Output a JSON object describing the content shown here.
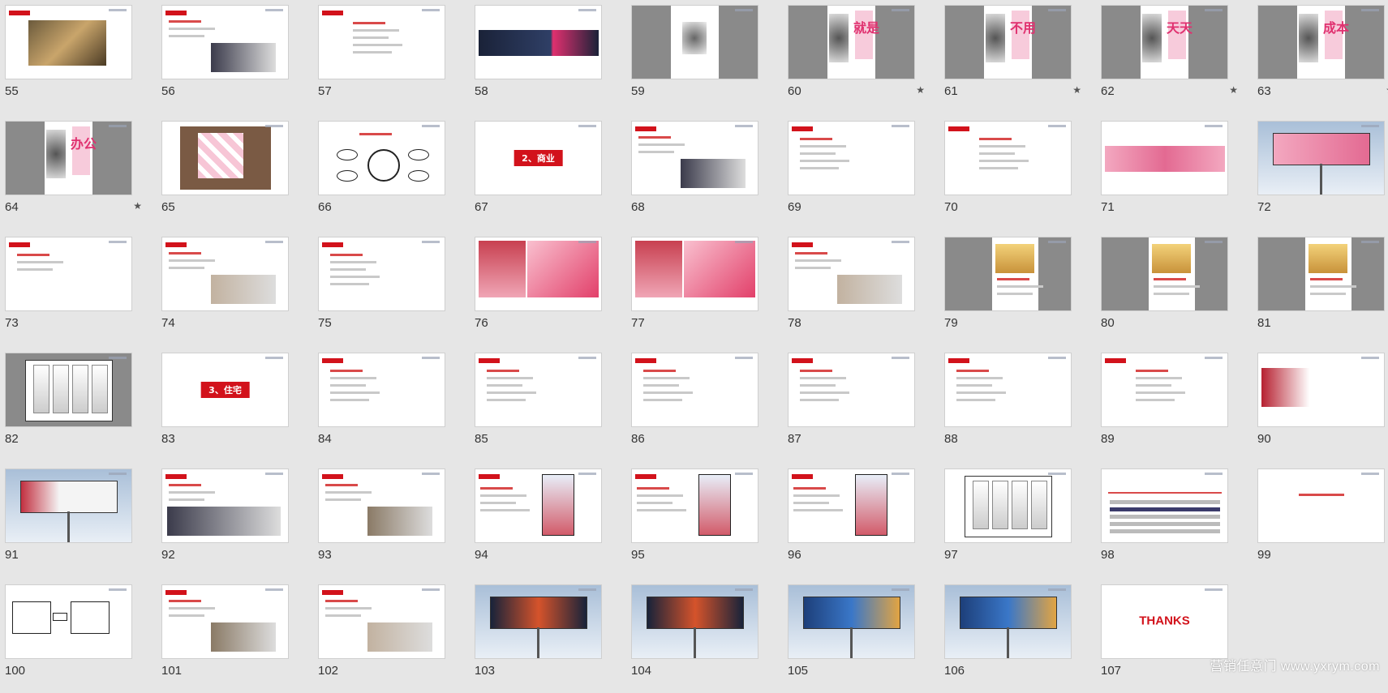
{
  "slides": [
    {
      "num": "55",
      "style": "photo-room"
    },
    {
      "num": "56",
      "style": "text-photo"
    },
    {
      "num": "57",
      "style": "text-center"
    },
    {
      "num": "58",
      "style": "dark-banner"
    },
    {
      "num": "59",
      "style": "grey-poster"
    },
    {
      "num": "60",
      "style": "poster",
      "star": true,
      "big": "就是"
    },
    {
      "num": "61",
      "style": "poster",
      "star": true,
      "big": "不用"
    },
    {
      "num": "62",
      "style": "poster",
      "star": true,
      "big": "天天"
    },
    {
      "num": "63",
      "style": "poster",
      "star": true,
      "big": "成本"
    },
    {
      "num": "64",
      "style": "poster",
      "star": true,
      "big": "办公"
    },
    {
      "num": "65",
      "style": "cards"
    },
    {
      "num": "66",
      "style": "diagram"
    },
    {
      "num": "67",
      "style": "section",
      "title": "2、商业"
    },
    {
      "num": "68",
      "style": "text-photo2"
    },
    {
      "num": "69",
      "style": "text"
    },
    {
      "num": "70",
      "style": "text-center"
    },
    {
      "num": "71",
      "style": "pink-banner"
    },
    {
      "num": "72",
      "style": "billboard-pink"
    },
    {
      "num": "73",
      "style": "text-small"
    },
    {
      "num": "74",
      "style": "text-photo3"
    },
    {
      "num": "75",
      "style": "text"
    },
    {
      "num": "76",
      "style": "models"
    },
    {
      "num": "77",
      "style": "models2"
    },
    {
      "num": "78",
      "style": "text-photo4"
    },
    {
      "num": "79",
      "style": "grey-poster2"
    },
    {
      "num": "80",
      "style": "grey-poster2"
    },
    {
      "num": "81",
      "style": "grey-poster2"
    },
    {
      "num": "82",
      "style": "phones-grey"
    },
    {
      "num": "83",
      "style": "section",
      "title": "3、住宅"
    },
    {
      "num": "84",
      "style": "text"
    },
    {
      "num": "85",
      "style": "text"
    },
    {
      "num": "86",
      "style": "text"
    },
    {
      "num": "87",
      "style": "text"
    },
    {
      "num": "88",
      "style": "text"
    },
    {
      "num": "89",
      "style": "text-center"
    },
    {
      "num": "90",
      "style": "banner-ad"
    },
    {
      "num": "91",
      "style": "billboard-ad"
    },
    {
      "num": "92",
      "style": "text-photo5"
    },
    {
      "num": "93",
      "style": "text-phone"
    },
    {
      "num": "94",
      "style": "text-poster"
    },
    {
      "num": "95",
      "style": "text-poster"
    },
    {
      "num": "96",
      "style": "text-poster"
    },
    {
      "num": "97",
      "style": "phones"
    },
    {
      "num": "98",
      "style": "table"
    },
    {
      "num": "99",
      "style": "text-center-red"
    },
    {
      "num": "100",
      "style": "flow"
    },
    {
      "num": "101",
      "style": "text-photo6"
    },
    {
      "num": "102",
      "style": "text-photo7"
    },
    {
      "num": "103",
      "style": "billboard-city"
    },
    {
      "num": "104",
      "style": "billboard-city"
    },
    {
      "num": "105",
      "style": "billboard-blue"
    },
    {
      "num": "106",
      "style": "billboard-blue"
    },
    {
      "num": "107",
      "style": "thanks",
      "title": "THANKS"
    }
  ],
  "watermark": "营销任意门 www.yxrym.com",
  "colors": {
    "accent": "#d2121b",
    "background": "#e6e6e6",
    "pink": "#e0306f"
  }
}
